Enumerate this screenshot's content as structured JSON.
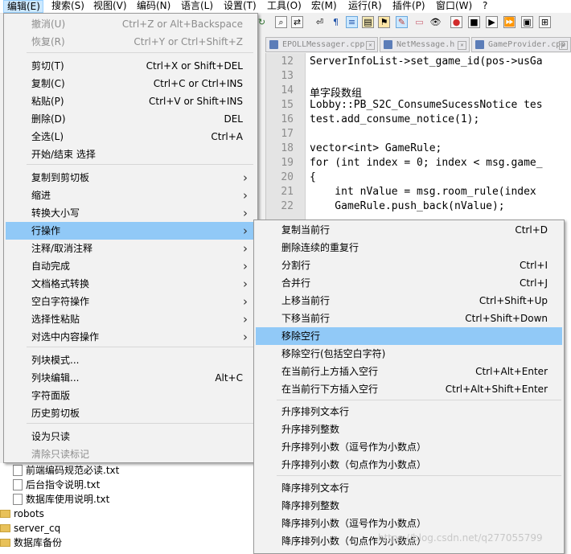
{
  "menubar": {
    "items": [
      "编辑(E)",
      "搜索(S)",
      "视图(V)",
      "编码(N)",
      "语言(L)",
      "设置(T)",
      "工具(O)",
      "宏(M)",
      "运行(R)",
      "插件(P)",
      "窗口(W)",
      "?"
    ]
  },
  "tabs": [
    {
      "label": "EPOLLMessager.cpp"
    },
    {
      "label": "NetMessage.h"
    },
    {
      "label": "GameProvider.cpp"
    }
  ],
  "editor": {
    "lines": [
      {
        "num": "12",
        "text": "ServerInfoList->set_game_id(pos->usGa"
      },
      {
        "num": "13",
        "text": ""
      },
      {
        "num": "14",
        "text": "单字段数组"
      },
      {
        "num": "15",
        "text": "Lobby::PB_S2C_ConsumeSucessNotice tes"
      },
      {
        "num": "16",
        "text": "test.add_consume_notice(1);"
      },
      {
        "num": "17",
        "text": ""
      },
      {
        "num": "18",
        "text": "vector<int> GameRule;"
      },
      {
        "num": "19",
        "text": "for (int index = 0; index < msg.game_"
      },
      {
        "num": "20",
        "text": "{"
      },
      {
        "num": "21",
        "text": "    int nValue = msg.room_rule(index"
      },
      {
        "num": "22",
        "text": "    GameRule.push_back(nValue);"
      }
    ]
  },
  "edit_menu": {
    "items": [
      {
        "label": "撤消(U)",
        "shortcut": "Ctrl+Z or Alt+Backspace",
        "disabled": true
      },
      {
        "label": "恢复(R)",
        "shortcut": "Ctrl+Y or Ctrl+Shift+Z",
        "disabled": true
      },
      {
        "label": "剪切(T)",
        "shortcut": "Ctrl+X or Shift+DEL"
      },
      {
        "label": "复制(C)",
        "shortcut": "Ctrl+C or Ctrl+INS"
      },
      {
        "label": "粘贴(P)",
        "shortcut": "Ctrl+V or Shift+INS"
      },
      {
        "label": "删除(D)",
        "shortcut": "DEL"
      },
      {
        "label": "全选(L)",
        "shortcut": "Ctrl+A"
      },
      {
        "label": "开始/结束 选择",
        "shortcut": ""
      },
      {
        "label": "复制到剪切板",
        "submenu": true
      },
      {
        "label": "缩进",
        "submenu": true
      },
      {
        "label": "转换大小写",
        "submenu": true
      },
      {
        "label": "行操作",
        "submenu": true,
        "active": true
      },
      {
        "label": "注释/取消注释",
        "submenu": true
      },
      {
        "label": "自动完成",
        "submenu": true
      },
      {
        "label": "文档格式转换",
        "submenu": true
      },
      {
        "label": "空白字符操作",
        "submenu": true
      },
      {
        "label": "选择性粘贴",
        "submenu": true
      },
      {
        "label": "对选中内容操作",
        "submenu": true
      },
      {
        "label": "列块模式...",
        "shortcut": ""
      },
      {
        "label": "列块编辑...",
        "shortcut": "Alt+C"
      },
      {
        "label": "字符面版",
        "shortcut": ""
      },
      {
        "label": "历史剪切板",
        "shortcut": ""
      },
      {
        "label": "设为只读",
        "shortcut": ""
      },
      {
        "label": "清除只读标记",
        "shortcut": "",
        "disabled": true
      }
    ]
  },
  "line_menu": {
    "items": [
      {
        "label": "复制当前行",
        "shortcut": "Ctrl+D"
      },
      {
        "label": "删除连续的重复行",
        "shortcut": ""
      },
      {
        "label": "分割行",
        "shortcut": "Ctrl+I"
      },
      {
        "label": "合并行",
        "shortcut": "Ctrl+J"
      },
      {
        "label": "上移当前行",
        "shortcut": "Ctrl+Shift+Up"
      },
      {
        "label": "下移当前行",
        "shortcut": "Ctrl+Shift+Down"
      },
      {
        "label": "移除空行",
        "shortcut": "",
        "hover": true
      },
      {
        "label": "移除空行(包括空白字符)",
        "shortcut": ""
      },
      {
        "label": "在当前行上方插入空行",
        "shortcut": "Ctrl+Alt+Enter"
      },
      {
        "label": "在当前行下方插入空行",
        "shortcut": "Ctrl+Alt+Shift+Enter"
      },
      {
        "label": "升序排列文本行",
        "shortcut": ""
      },
      {
        "label": "升序排列整数",
        "shortcut": ""
      },
      {
        "label": "升序排列小数（逗号作为小数点）",
        "shortcut": ""
      },
      {
        "label": "升序排列小数（句点作为小数点）",
        "shortcut": ""
      },
      {
        "label": "降序排列文本行",
        "shortcut": ""
      },
      {
        "label": "降序排列整数",
        "shortcut": ""
      },
      {
        "label": "降序排列小数（逗号作为小数点）",
        "shortcut": ""
      },
      {
        "label": "降序排列小数（句点作为小数点）",
        "shortcut": ""
      }
    ]
  },
  "tree": {
    "items": [
      {
        "label": "前端编码规范必读.txt",
        "kind": "file"
      },
      {
        "label": "后台指令说明.txt",
        "kind": "file"
      },
      {
        "label": "数据库使用说明.txt",
        "kind": "file"
      },
      {
        "label": "robots",
        "kind": "folder"
      },
      {
        "label": "server_cq",
        "kind": "folder"
      },
      {
        "label": "数据库备份",
        "kind": "folder"
      }
    ]
  },
  "watermark": "https://blog.csdn.net/q277055799"
}
